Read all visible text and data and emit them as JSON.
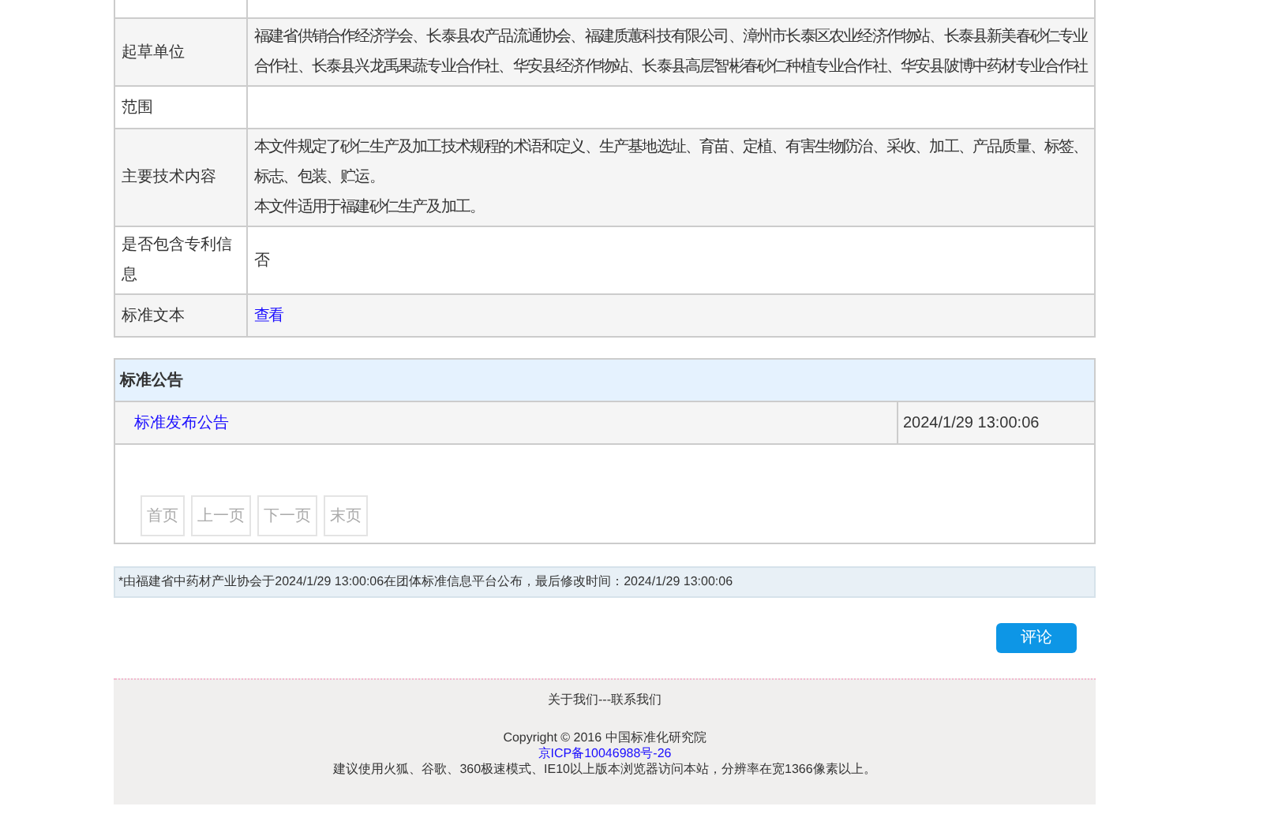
{
  "details": [
    {
      "label": "起草单位",
      "lines": [
        "福建省供销合作经济学会、长泰县农产品流通协会、福建质蕙科技有限公司、漳州市长泰区农业经济作物站、长泰县新美春砂仁专业合作社、长泰县兴龙禹果蔬专业合作社、华安县经济作物站、长泰县高层智彬春砂仁种植专业合作社、华安县陂博中药材专业合作社"
      ],
      "kind": "text"
    },
    {
      "label": "范围"
    },
    {
      "label": "主要技术内容",
      "lines": [
        "本文件规定了砂仁生产及加工技术规程的术语和定义、生产基地选址、育苗、定植、有害生物防治、采收、加工、产品质量、标签、标志、包装、贮运。",
        "本文件适用于福建砂仁生产及加工。"
      ],
      "kind": "text"
    },
    {
      "label": "是否包含专利信息",
      "lines": [
        "否"
      ],
      "kind": "text"
    },
    {
      "label": "标准文本",
      "lines": [
        "查看"
      ],
      "kind": "link"
    }
  ],
  "announcements": {
    "title": "标准公告",
    "rows": [
      {
        "title": "标准发布公告",
        "date": "2024/1/29 13:00:06"
      }
    ],
    "pager": [
      {
        "label": "首页",
        "disabled": true
      },
      {
        "label": "上一页",
        "disabled": true
      },
      {
        "label": "下一页",
        "disabled": true
      },
      {
        "label": "末页",
        "disabled": true
      }
    ]
  },
  "note": "*由福建省中药材产业协会于2024/1/29 13:00:06在团体标准信息平台公布，最后修改时间：2024/1/29 13:00:06",
  "comment_button": "评论",
  "footer": {
    "links": "关于我们---联系我们",
    "copyright": "Copyright © 2016 中国标准化研究院",
    "icp": "京ICP备10046988号-26",
    "advice": "建议使用火狐、谷歌、360极速模式、IE10以上版本浏览器访问本站，分辨率在宽1366像素以上。"
  }
}
